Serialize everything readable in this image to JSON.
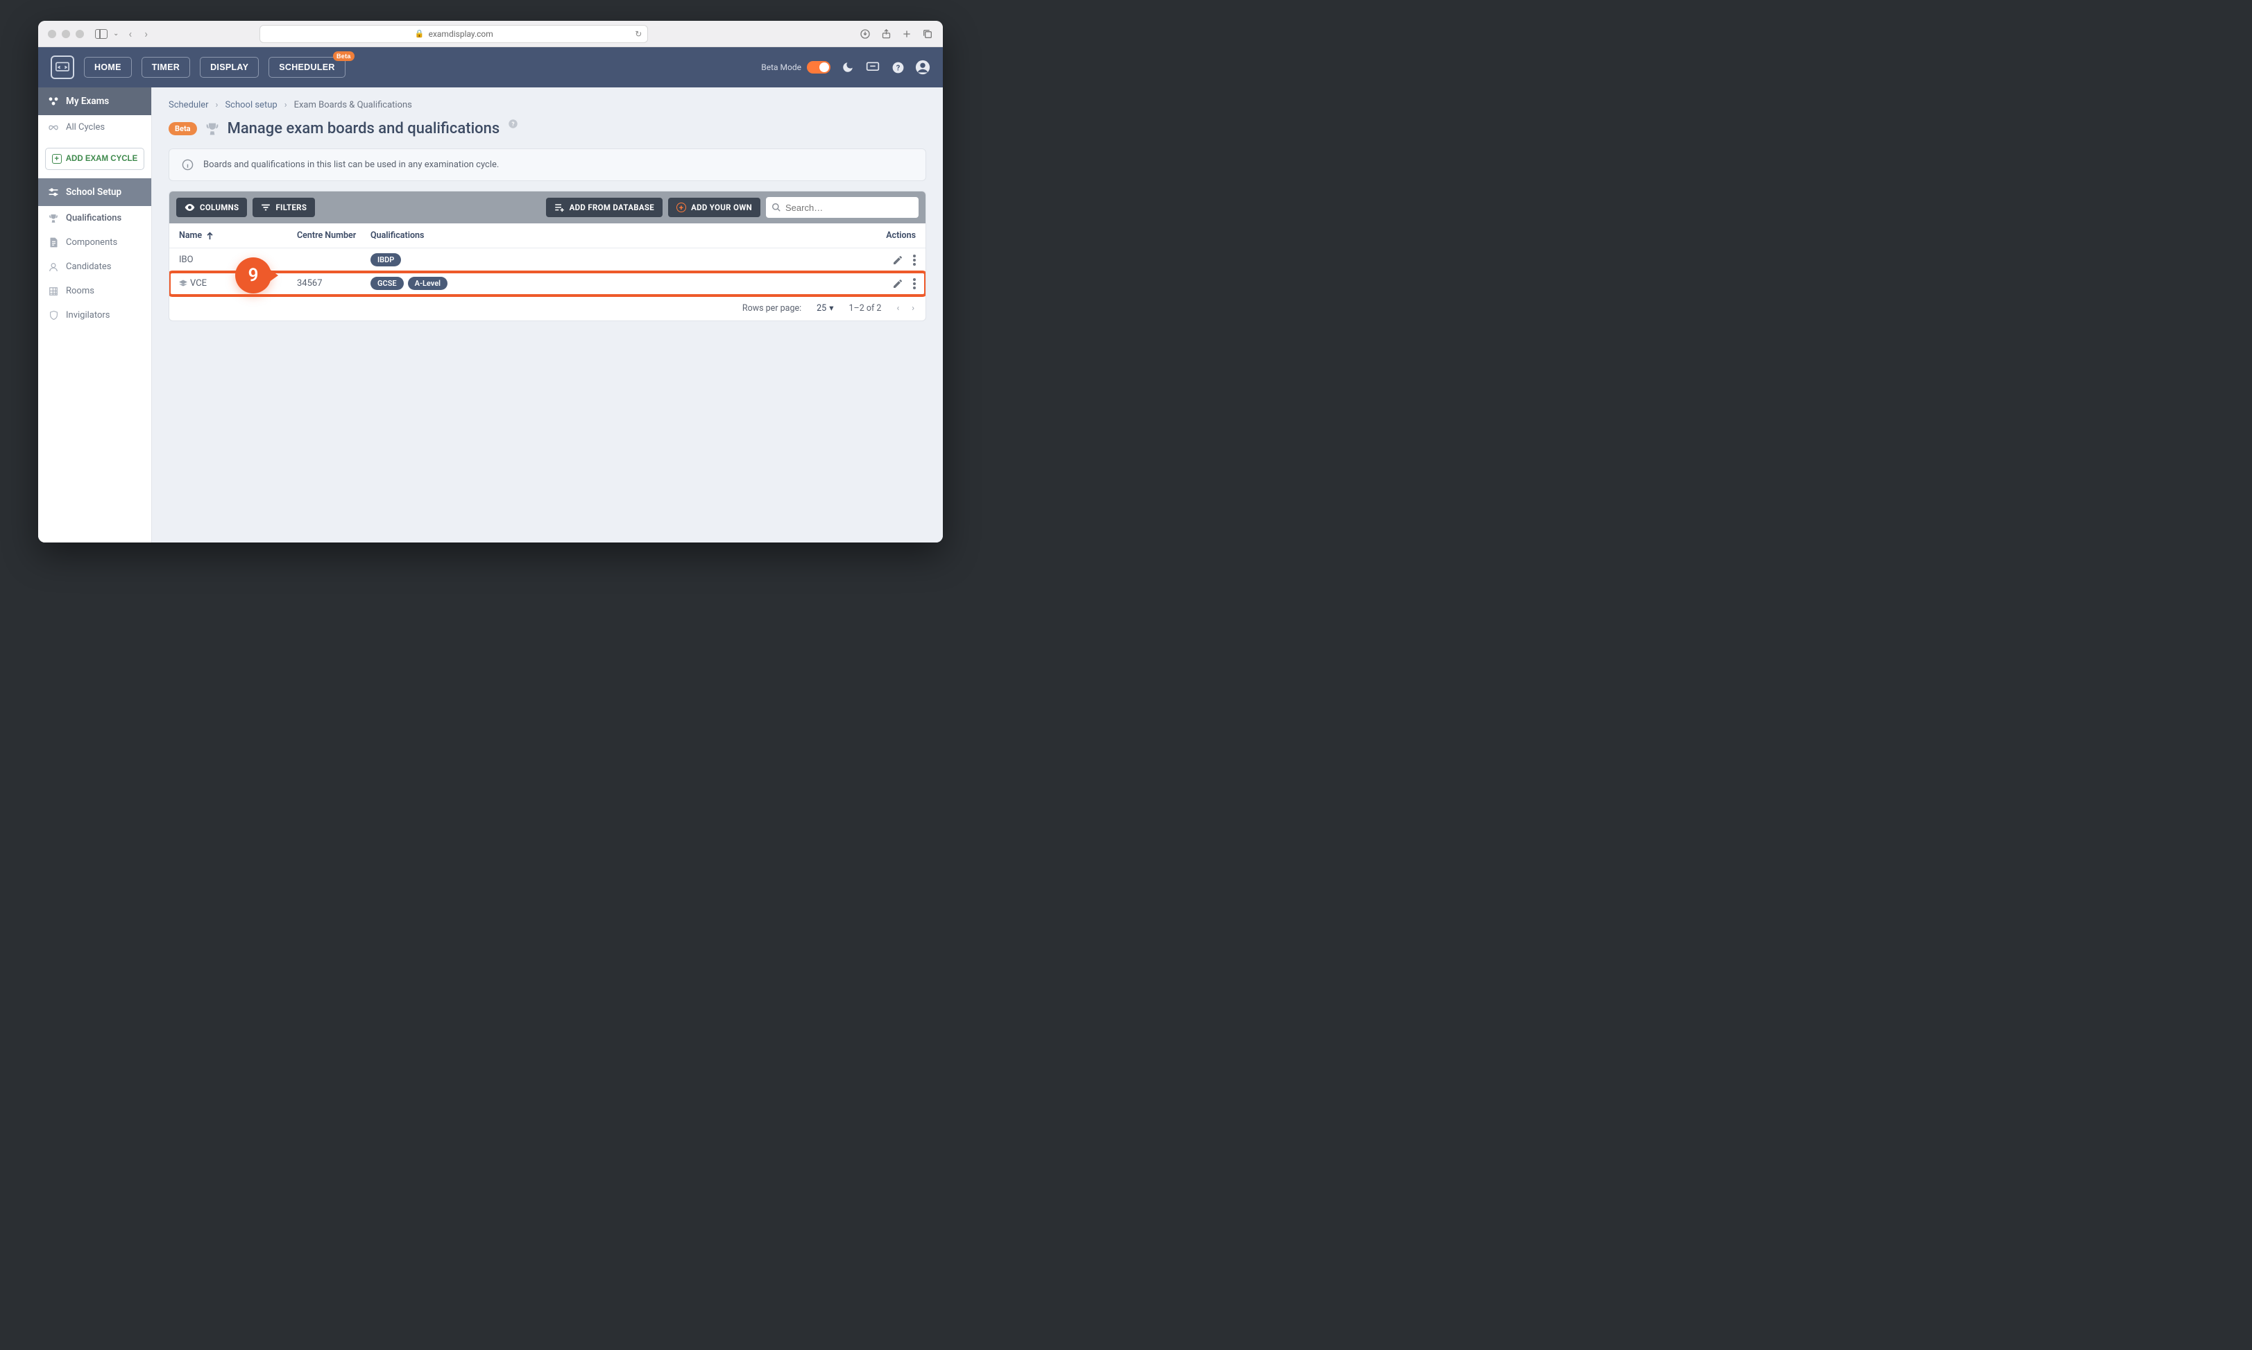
{
  "browser": {
    "url_host": "examdisplay.com"
  },
  "header": {
    "nav": {
      "home": "HOME",
      "timer": "TIMER",
      "display": "DISPLAY",
      "scheduler": "SCHEDULER",
      "scheduler_badge": "Beta"
    },
    "beta_mode_label": "Beta Mode"
  },
  "sidebar": {
    "my_exams": "My Exams",
    "all_cycles": "All Cycles",
    "add_cycle": "ADD EXAM CYCLE",
    "school_setup": "School Setup",
    "items": {
      "qualifications": "Qualifications",
      "components": "Components",
      "candidates": "Candidates",
      "rooms": "Rooms",
      "invigilators": "Invigilators"
    }
  },
  "crumbs": {
    "a": "Scheduler",
    "b": "School setup",
    "c": "Exam Boards & Qualifications"
  },
  "page": {
    "beta": "Beta",
    "title": "Manage exam boards and qualifications",
    "info": "Boards and qualifications in this list can be used in any examination cycle."
  },
  "toolbar": {
    "columns": "COLUMNS",
    "filters": "FILTERS",
    "add_db": "ADD FROM DATABASE",
    "add_own": "ADD YOUR OWN",
    "search_placeholder": "Search…"
  },
  "table": {
    "head": {
      "name": "Name",
      "centre": "Centre Number",
      "quals": "Qualifications",
      "actions": "Actions"
    },
    "rows": [
      {
        "name": "IBO",
        "centre": "",
        "quals": [
          "IBDP"
        ]
      },
      {
        "name": "VCE",
        "centre": "34567",
        "quals": [
          "GCSE",
          "A-Level"
        ]
      }
    ],
    "footer": {
      "rpp_label": "Rows per page:",
      "rpp_value": "25",
      "range": "1–2 of 2"
    }
  },
  "step": {
    "number": "9"
  }
}
